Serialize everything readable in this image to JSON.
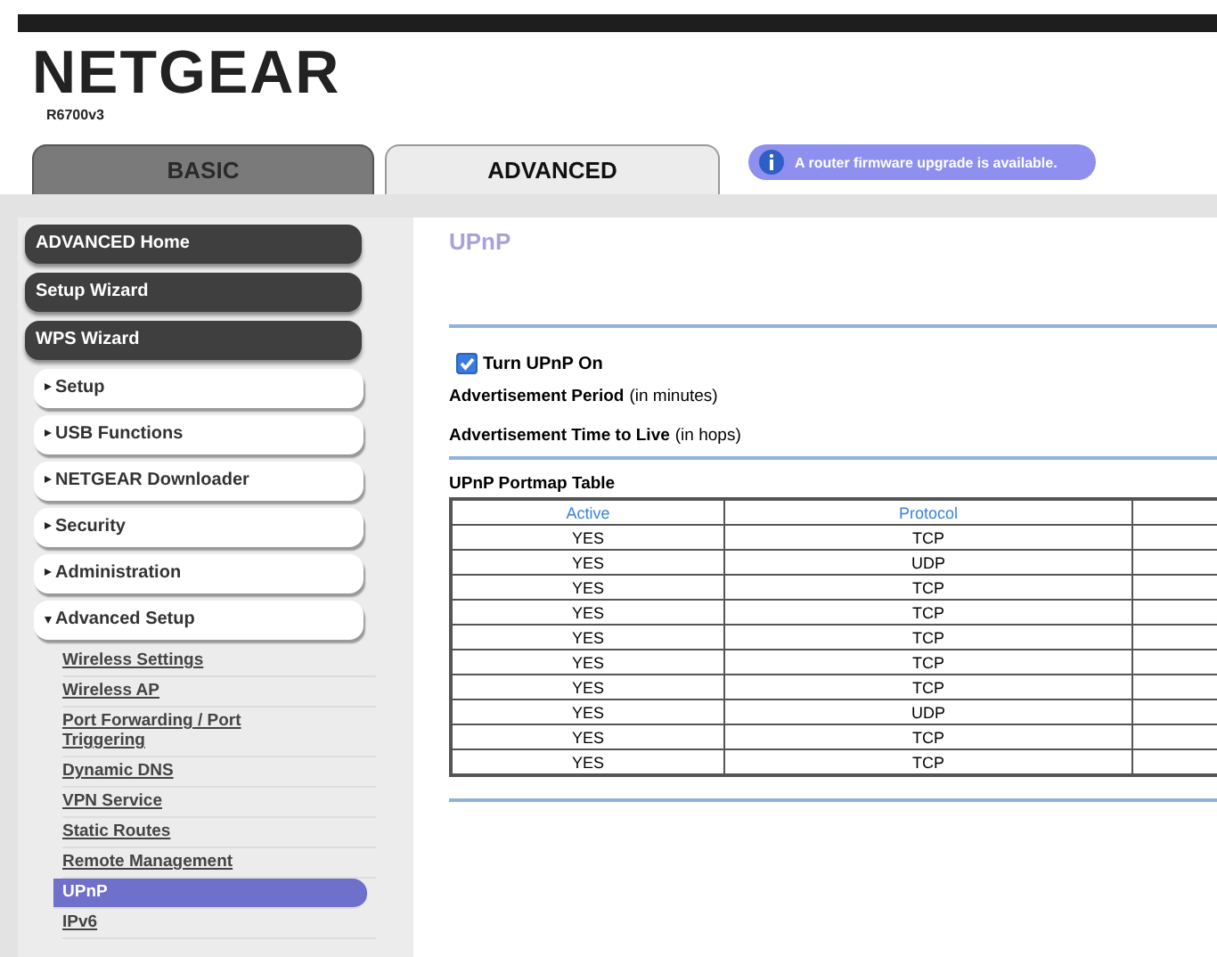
{
  "header": {
    "logo": "NETGEAR",
    "model": "R6700v3"
  },
  "tabs": [
    {
      "label": "BASIC",
      "selected": false
    },
    {
      "label": "ADVANCED",
      "selected": true
    }
  ],
  "notice": {
    "text": "A router firmware upgrade is available."
  },
  "sidebar": {
    "items": [
      {
        "kind": "main",
        "label": "ADVANCED Home"
      },
      {
        "kind": "main",
        "label": "Setup Wizard"
      },
      {
        "kind": "main",
        "label": "WPS Wizard"
      },
      {
        "kind": "section",
        "label": "Setup",
        "expanded": false
      },
      {
        "kind": "section",
        "label": "USB Functions",
        "expanded": false
      },
      {
        "kind": "section",
        "label": "NETGEAR Downloader",
        "expanded": false
      },
      {
        "kind": "section",
        "label": "Security",
        "expanded": false
      },
      {
        "kind": "section",
        "label": "Administration",
        "expanded": false
      },
      {
        "kind": "section",
        "label": "Advanced Setup",
        "expanded": true,
        "children": [
          {
            "label": "Wireless Settings",
            "selected": false
          },
          {
            "label": "Wireless AP",
            "selected": false
          },
          {
            "label": "Port Forwarding / Port Triggering",
            "selected": false
          },
          {
            "label": "Dynamic DNS",
            "selected": false
          },
          {
            "label": "VPN Service",
            "selected": false
          },
          {
            "label": "Static Routes",
            "selected": false
          },
          {
            "label": "Remote Management",
            "selected": false
          },
          {
            "label": "UPnP",
            "selected": true
          },
          {
            "label": "IPv6",
            "selected": false
          }
        ]
      }
    ]
  },
  "page": {
    "title": "UPnP",
    "upnp_toggle": {
      "label": "Turn UPnP On",
      "checked": true
    },
    "fields": [
      {
        "label": "Advertisement Period",
        "unit": "(in minutes)"
      },
      {
        "label": "Advertisement Time to Live",
        "unit": "(in hops)"
      }
    ],
    "table": {
      "title": "UPnP Portmap Table",
      "columns": [
        "Active",
        "Protocol"
      ],
      "rows": [
        [
          "YES",
          "TCP"
        ],
        [
          "YES",
          "UDP"
        ],
        [
          "YES",
          "TCP"
        ],
        [
          "YES",
          "TCP"
        ],
        [
          "YES",
          "TCP"
        ],
        [
          "YES",
          "TCP"
        ],
        [
          "YES",
          "TCP"
        ],
        [
          "YES",
          "UDP"
        ],
        [
          "YES",
          "TCP"
        ],
        [
          "YES",
          "TCP"
        ]
      ]
    }
  }
}
